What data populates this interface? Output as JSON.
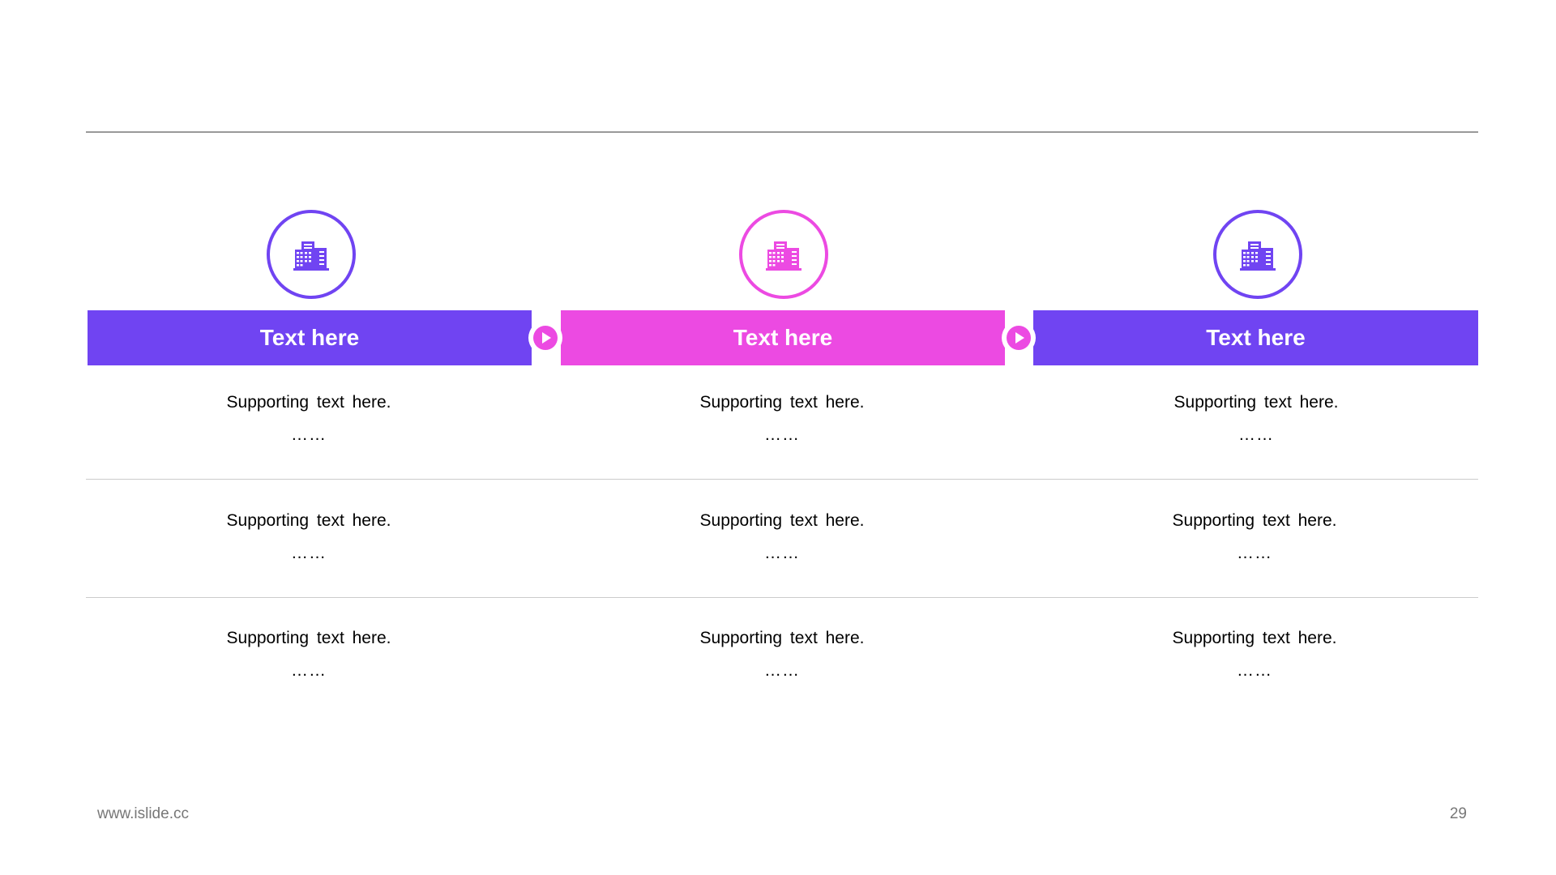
{
  "colors": {
    "purple": "#7044f2",
    "magenta": "#ec4ae2",
    "rule": "#999999",
    "footer_text": "#777777"
  },
  "columns": [
    {
      "icon": "building-icon",
      "accent": "#7044f2",
      "title": "Text here",
      "rows": [
        {
          "text": "Supporting text here.",
          "dots": "……"
        },
        {
          "text": "Supporting text here.",
          "dots": "……"
        },
        {
          "text": "Supporting text here.",
          "dots": "……"
        }
      ]
    },
    {
      "icon": "building-icon",
      "accent": "#ec4ae2",
      "title": "Text here",
      "rows": [
        {
          "text": "Supporting text here.",
          "dots": "……"
        },
        {
          "text": "Supporting text here.",
          "dots": "……"
        },
        {
          "text": "Supporting text here.",
          "dots": "……"
        }
      ]
    },
    {
      "icon": "building-icon",
      "accent": "#7044f2",
      "title": "Text here",
      "rows": [
        {
          "text": "Supporting text here.",
          "dots": "……"
        },
        {
          "text": "Supporting text here.",
          "dots": "……"
        },
        {
          "text": "Supporting text here.",
          "dots": "……"
        }
      ]
    }
  ],
  "arrows": [
    {
      "icon": "play-arrow-icon",
      "color": "#ec4ae2"
    },
    {
      "icon": "play-arrow-icon",
      "color": "#ec4ae2"
    }
  ],
  "footer": {
    "website": "www.islide.cc",
    "page_number": "29"
  }
}
